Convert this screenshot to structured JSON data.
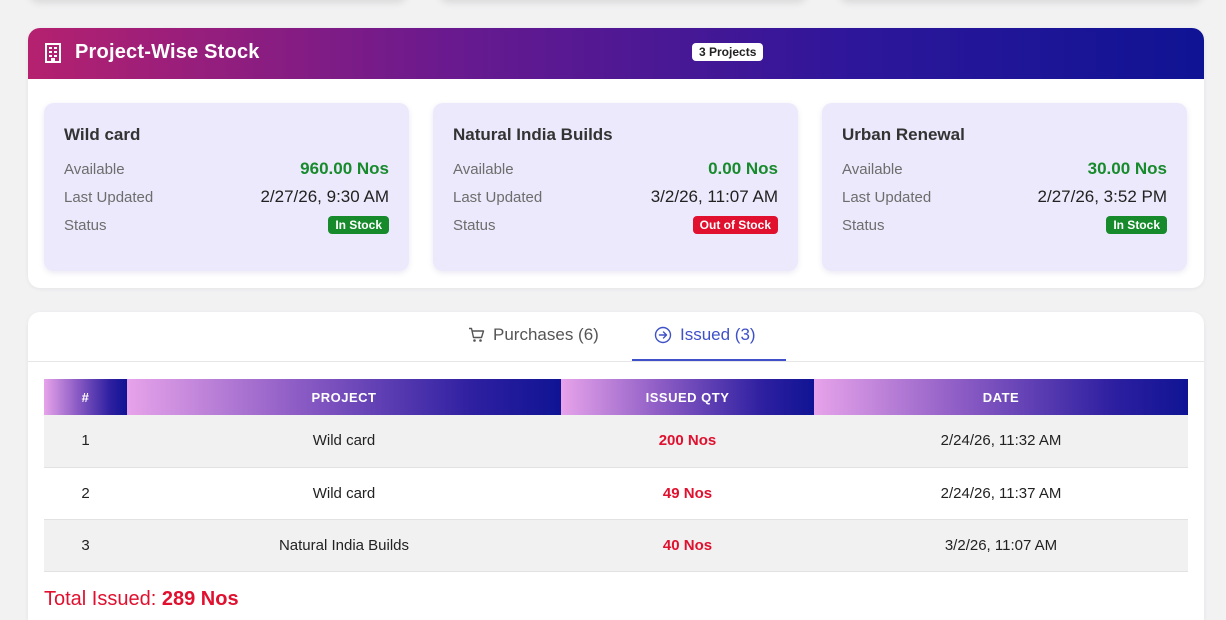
{
  "stock_panel": {
    "title": "Project-Wise Stock",
    "project_count": "3 Projects",
    "available_label": "Available",
    "updated_label": "Last Updated",
    "status_label": "Status",
    "projects": [
      {
        "name": "Wild card",
        "available": "960.00 Nos",
        "last_updated": "2/27/26, 9:30 AM",
        "status": "In Stock"
      },
      {
        "name": "Natural India Builds",
        "available": "0.00 Nos",
        "last_updated": "3/2/26, 11:07 AM",
        "status": "Out of Stock"
      },
      {
        "name": "Urban Renewal",
        "available": "30.00 Nos",
        "last_updated": "2/27/26, 3:52 PM",
        "status": "In Stock"
      }
    ]
  },
  "tabs": {
    "purchases": "Purchases (6)",
    "issued": "Issued (3)",
    "active": "issued"
  },
  "table": {
    "columns": [
      "#",
      "PROJECT",
      "ISSUED QTY",
      "DATE"
    ],
    "rows": [
      {
        "num": "1",
        "project": "Wild card",
        "qty": "200 Nos",
        "date": "2/24/26, 11:32 AM"
      },
      {
        "num": "2",
        "project": "Wild card",
        "qty": "49 Nos",
        "date": "2/24/26, 11:37 AM"
      },
      {
        "num": "3",
        "project": "Natural India Builds",
        "qty": "40 Nos",
        "date": "3/2/26, 11:07 AM"
      }
    ]
  },
  "total": {
    "label": "Total Issued:",
    "value": "289 Nos"
  },
  "colors": {
    "in_stock": "#178a2c",
    "out_of_stock": "#e0102e",
    "accent": "#3f51c9"
  }
}
